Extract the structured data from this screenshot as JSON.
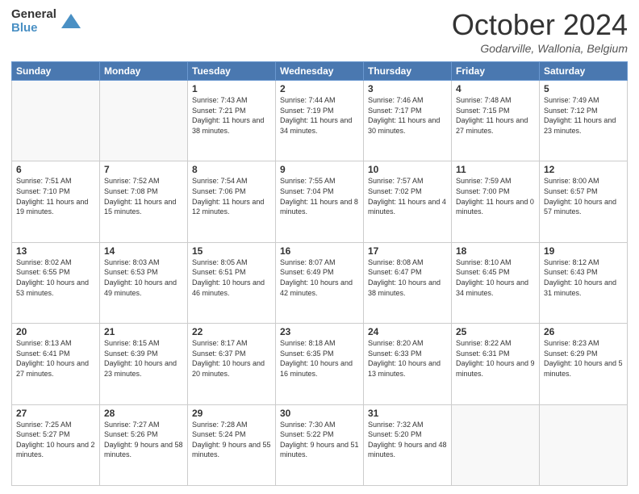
{
  "logo": {
    "general": "General",
    "blue": "Blue"
  },
  "header": {
    "month": "October 2024",
    "location": "Godarville, Wallonia, Belgium"
  },
  "weekdays": [
    "Sunday",
    "Monday",
    "Tuesday",
    "Wednesday",
    "Thursday",
    "Friday",
    "Saturday"
  ],
  "weeks": [
    [
      {
        "day": null
      },
      {
        "day": null
      },
      {
        "day": "1",
        "sunrise": "Sunrise: 7:43 AM",
        "sunset": "Sunset: 7:21 PM",
        "daylight": "Daylight: 11 hours and 38 minutes."
      },
      {
        "day": "2",
        "sunrise": "Sunrise: 7:44 AM",
        "sunset": "Sunset: 7:19 PM",
        "daylight": "Daylight: 11 hours and 34 minutes."
      },
      {
        "day": "3",
        "sunrise": "Sunrise: 7:46 AM",
        "sunset": "Sunset: 7:17 PM",
        "daylight": "Daylight: 11 hours and 30 minutes."
      },
      {
        "day": "4",
        "sunrise": "Sunrise: 7:48 AM",
        "sunset": "Sunset: 7:15 PM",
        "daylight": "Daylight: 11 hours and 27 minutes."
      },
      {
        "day": "5",
        "sunrise": "Sunrise: 7:49 AM",
        "sunset": "Sunset: 7:12 PM",
        "daylight": "Daylight: 11 hours and 23 minutes."
      }
    ],
    [
      {
        "day": "6",
        "sunrise": "Sunrise: 7:51 AM",
        "sunset": "Sunset: 7:10 PM",
        "daylight": "Daylight: 11 hours and 19 minutes."
      },
      {
        "day": "7",
        "sunrise": "Sunrise: 7:52 AM",
        "sunset": "Sunset: 7:08 PM",
        "daylight": "Daylight: 11 hours and 15 minutes."
      },
      {
        "day": "8",
        "sunrise": "Sunrise: 7:54 AM",
        "sunset": "Sunset: 7:06 PM",
        "daylight": "Daylight: 11 hours and 12 minutes."
      },
      {
        "day": "9",
        "sunrise": "Sunrise: 7:55 AM",
        "sunset": "Sunset: 7:04 PM",
        "daylight": "Daylight: 11 hours and 8 minutes."
      },
      {
        "day": "10",
        "sunrise": "Sunrise: 7:57 AM",
        "sunset": "Sunset: 7:02 PM",
        "daylight": "Daylight: 11 hours and 4 minutes."
      },
      {
        "day": "11",
        "sunrise": "Sunrise: 7:59 AM",
        "sunset": "Sunset: 7:00 PM",
        "daylight": "Daylight: 11 hours and 0 minutes."
      },
      {
        "day": "12",
        "sunrise": "Sunrise: 8:00 AM",
        "sunset": "Sunset: 6:57 PM",
        "daylight": "Daylight: 10 hours and 57 minutes."
      }
    ],
    [
      {
        "day": "13",
        "sunrise": "Sunrise: 8:02 AM",
        "sunset": "Sunset: 6:55 PM",
        "daylight": "Daylight: 10 hours and 53 minutes."
      },
      {
        "day": "14",
        "sunrise": "Sunrise: 8:03 AM",
        "sunset": "Sunset: 6:53 PM",
        "daylight": "Daylight: 10 hours and 49 minutes."
      },
      {
        "day": "15",
        "sunrise": "Sunrise: 8:05 AM",
        "sunset": "Sunset: 6:51 PM",
        "daylight": "Daylight: 10 hours and 46 minutes."
      },
      {
        "day": "16",
        "sunrise": "Sunrise: 8:07 AM",
        "sunset": "Sunset: 6:49 PM",
        "daylight": "Daylight: 10 hours and 42 minutes."
      },
      {
        "day": "17",
        "sunrise": "Sunrise: 8:08 AM",
        "sunset": "Sunset: 6:47 PM",
        "daylight": "Daylight: 10 hours and 38 minutes."
      },
      {
        "day": "18",
        "sunrise": "Sunrise: 8:10 AM",
        "sunset": "Sunset: 6:45 PM",
        "daylight": "Daylight: 10 hours and 34 minutes."
      },
      {
        "day": "19",
        "sunrise": "Sunrise: 8:12 AM",
        "sunset": "Sunset: 6:43 PM",
        "daylight": "Daylight: 10 hours and 31 minutes."
      }
    ],
    [
      {
        "day": "20",
        "sunrise": "Sunrise: 8:13 AM",
        "sunset": "Sunset: 6:41 PM",
        "daylight": "Daylight: 10 hours and 27 minutes."
      },
      {
        "day": "21",
        "sunrise": "Sunrise: 8:15 AM",
        "sunset": "Sunset: 6:39 PM",
        "daylight": "Daylight: 10 hours and 23 minutes."
      },
      {
        "day": "22",
        "sunrise": "Sunrise: 8:17 AM",
        "sunset": "Sunset: 6:37 PM",
        "daylight": "Daylight: 10 hours and 20 minutes."
      },
      {
        "day": "23",
        "sunrise": "Sunrise: 8:18 AM",
        "sunset": "Sunset: 6:35 PM",
        "daylight": "Daylight: 10 hours and 16 minutes."
      },
      {
        "day": "24",
        "sunrise": "Sunrise: 8:20 AM",
        "sunset": "Sunset: 6:33 PM",
        "daylight": "Daylight: 10 hours and 13 minutes."
      },
      {
        "day": "25",
        "sunrise": "Sunrise: 8:22 AM",
        "sunset": "Sunset: 6:31 PM",
        "daylight": "Daylight: 10 hours and 9 minutes."
      },
      {
        "day": "26",
        "sunrise": "Sunrise: 8:23 AM",
        "sunset": "Sunset: 6:29 PM",
        "daylight": "Daylight: 10 hours and 5 minutes."
      }
    ],
    [
      {
        "day": "27",
        "sunrise": "Sunrise: 7:25 AM",
        "sunset": "Sunset: 5:27 PM",
        "daylight": "Daylight: 10 hours and 2 minutes."
      },
      {
        "day": "28",
        "sunrise": "Sunrise: 7:27 AM",
        "sunset": "Sunset: 5:26 PM",
        "daylight": "Daylight: 9 hours and 58 minutes."
      },
      {
        "day": "29",
        "sunrise": "Sunrise: 7:28 AM",
        "sunset": "Sunset: 5:24 PM",
        "daylight": "Daylight: 9 hours and 55 minutes."
      },
      {
        "day": "30",
        "sunrise": "Sunrise: 7:30 AM",
        "sunset": "Sunset: 5:22 PM",
        "daylight": "Daylight: 9 hours and 51 minutes."
      },
      {
        "day": "31",
        "sunrise": "Sunrise: 7:32 AM",
        "sunset": "Sunset: 5:20 PM",
        "daylight": "Daylight: 9 hours and 48 minutes."
      },
      {
        "day": null
      },
      {
        "day": null
      }
    ]
  ]
}
